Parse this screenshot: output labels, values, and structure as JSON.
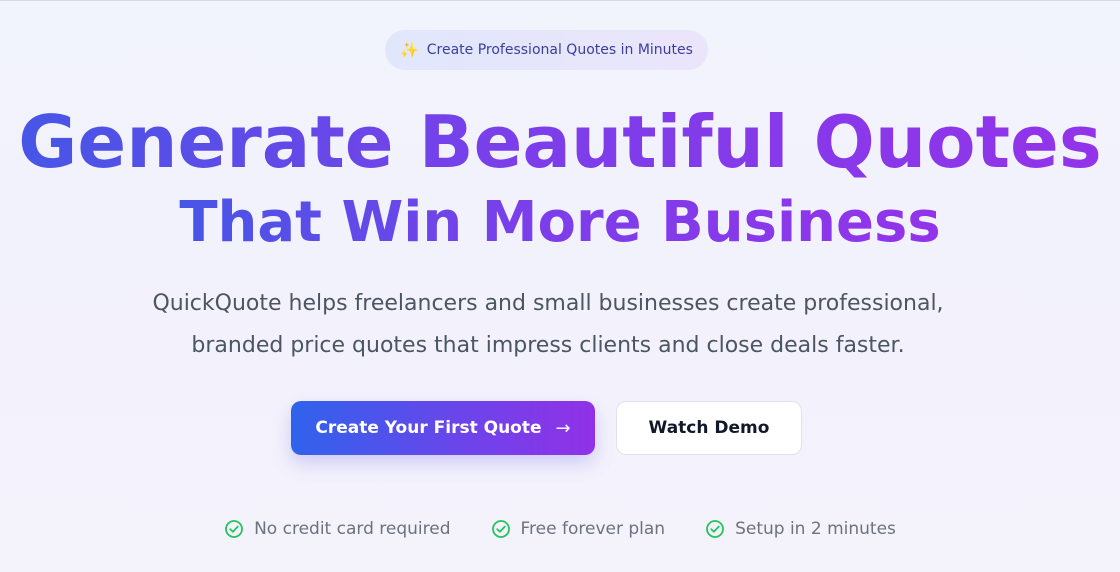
{
  "badge": {
    "icon": "sparkle-icon",
    "text": "Create Professional Quotes in Minutes"
  },
  "headline": {
    "line1": "Generate Beautiful Quotes",
    "line2": "That Win More Business"
  },
  "subheadline": {
    "line1": "QuickQuote helps freelancers and small businesses create professional,",
    "line2": "branded price quotes that impress clients and close deals faster."
  },
  "cta": {
    "primary_label": "Create Your First Quote",
    "primary_icon": "arrow-right-icon",
    "secondary_label": "Watch Demo"
  },
  "features": [
    {
      "icon": "check-circle-icon",
      "label": "No credit card required"
    },
    {
      "icon": "check-circle-icon",
      "label": "Free forever plan"
    },
    {
      "icon": "check-circle-icon",
      "label": "Setup in 2 minutes"
    }
  ],
  "colors": {
    "gradient_start": "#4656e6",
    "gradient_end": "#9333ea",
    "check_green": "#22c55e",
    "badge_text": "#3a3f9e"
  }
}
